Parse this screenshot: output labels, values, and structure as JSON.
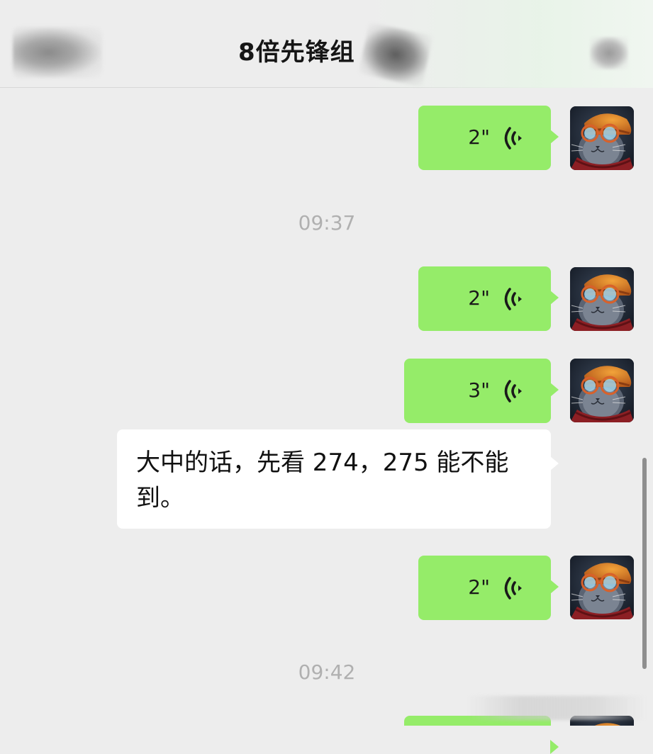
{
  "header": {
    "title": "8倍先锋组",
    "back_icon": "back-arrow-icon (blurred)",
    "more_icon": "more-dots-icon (blurred)"
  },
  "colors": {
    "sent_bubble": "#95ec69",
    "received_bubble": "#ffffff",
    "background": "#ededed",
    "timestamp": "#b0b0b0"
  },
  "messages": [
    {
      "type": "voice",
      "direction": "sent",
      "duration": "2\""
    },
    {
      "type": "timestamp",
      "text": "09:37"
    },
    {
      "type": "voice",
      "direction": "sent",
      "duration": "2\""
    },
    {
      "type": "voice",
      "direction": "sent",
      "duration": "3\""
    },
    {
      "type": "text",
      "direction": "received",
      "text": "大中的话，先看 274，275 能不能到。"
    },
    {
      "type": "voice",
      "direction": "sent",
      "duration": "2\""
    },
    {
      "type": "timestamp",
      "text": "09:42"
    }
  ]
}
